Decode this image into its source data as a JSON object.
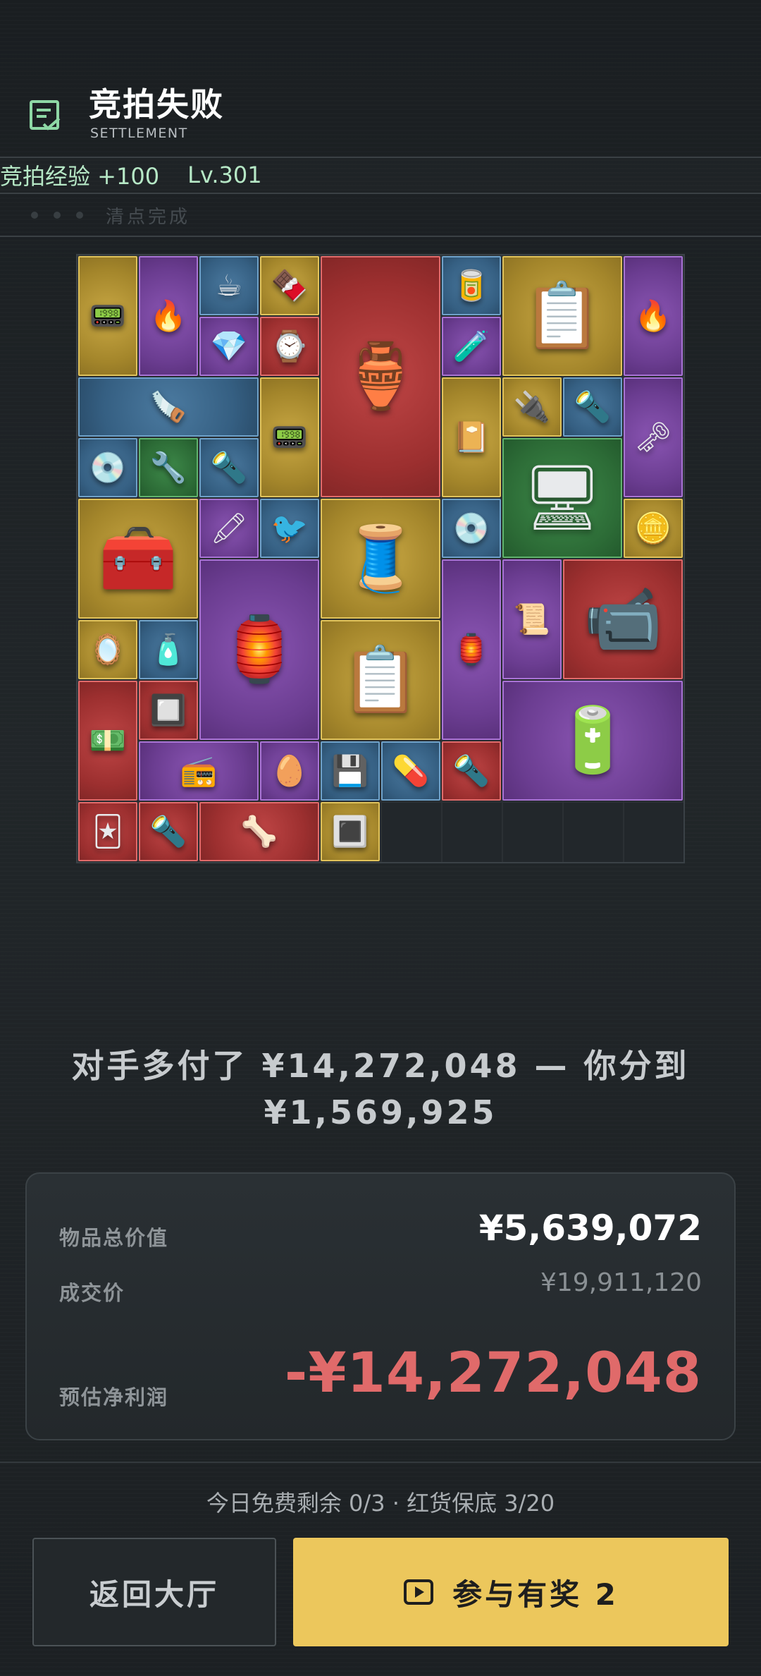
{
  "header": {
    "title": "竞拍失败",
    "subtitle": "SETTLEMENT",
    "exp_label": "竞拍经验 +100",
    "level": "Lv.301",
    "progress_label": "清点完成"
  },
  "items": [
    {
      "name": "handheld-device",
      "rarity": "yellow",
      "icon": "📟"
    },
    {
      "name": "blowtorch",
      "rarity": "purple",
      "icon": "🔥"
    },
    {
      "name": "coffee-bag",
      "rarity": "blue",
      "icon": "☕"
    },
    {
      "name": "chocolate-bar",
      "rarity": "yellow",
      "icon": "🍫"
    },
    {
      "name": "porcelain-ewer",
      "rarity": "red",
      "icon": "🏺"
    },
    {
      "name": "cylinder-container",
      "rarity": "blue",
      "icon": "🥫"
    },
    {
      "name": "clipboard-report",
      "rarity": "yellow",
      "icon": "📋"
    },
    {
      "name": "blowtorch-2",
      "rarity": "purple",
      "icon": "🔥"
    },
    {
      "name": "earrings",
      "rarity": "purple",
      "icon": "💎"
    },
    {
      "name": "watch-reel",
      "rarity": "red",
      "icon": "⌚"
    },
    {
      "name": "glowstick",
      "rarity": "purple",
      "icon": "🧪"
    },
    {
      "name": "hand-saw",
      "rarity": "blue",
      "icon": "🪚"
    },
    {
      "name": "handheld-device-2",
      "rarity": "yellow",
      "icon": "📟"
    },
    {
      "name": "leather-notebook",
      "rarity": "yellow",
      "icon": "📔"
    },
    {
      "name": "usb-key",
      "rarity": "yellow",
      "icon": "🔌"
    },
    {
      "name": "keychain-flashlight",
      "rarity": "blue",
      "icon": "🔦"
    },
    {
      "name": "ornate-key",
      "rarity": "purple",
      "icon": "🗝"
    },
    {
      "name": "cd-disc",
      "rarity": "blue",
      "icon": "💿"
    },
    {
      "name": "pliers",
      "rarity": "green",
      "icon": "🔧"
    },
    {
      "name": "carabiner-light",
      "rarity": "blue",
      "icon": "🔦"
    },
    {
      "name": "power-supply",
      "rarity": "green",
      "icon": "🖥"
    },
    {
      "name": "ammo-crate",
      "rarity": "yellow",
      "icon": "🧰"
    },
    {
      "name": "marker",
      "rarity": "purple",
      "icon": "🖍"
    },
    {
      "name": "bird-figurine",
      "rarity": "blue",
      "icon": "🐦"
    },
    {
      "name": "cable-reel",
      "rarity": "yellow",
      "icon": "🧵"
    },
    {
      "name": "cd-disc-2",
      "rarity": "blue",
      "icon": "💿"
    },
    {
      "name": "emblem-coin",
      "rarity": "yellow",
      "icon": "🪙"
    },
    {
      "name": "moroccan-lamp",
      "rarity": "purple",
      "icon": "🏮"
    },
    {
      "name": "old-lantern",
      "rarity": "purple",
      "icon": "🏮"
    },
    {
      "name": "old-scroll",
      "rarity": "purple",
      "icon": "📜"
    },
    {
      "name": "camcorder",
      "rarity": "red",
      "icon": "📹"
    },
    {
      "name": "compact-mirror",
      "rarity": "yellow",
      "icon": "🪞"
    },
    {
      "name": "spray-bottle",
      "rarity": "blue",
      "icon": "🧴"
    },
    {
      "name": "clipboard-report-2",
      "rarity": "yellow",
      "icon": "📋"
    },
    {
      "name": "car-battery",
      "rarity": "purple",
      "icon": "🔋"
    },
    {
      "name": "banknote",
      "rarity": "red",
      "icon": "💵"
    },
    {
      "name": "circuit-module",
      "rarity": "red",
      "icon": "🔲"
    },
    {
      "name": "boombox",
      "rarity": "purple",
      "icon": "📻"
    },
    {
      "name": "fossil-egg",
      "rarity": "purple",
      "icon": "🥚"
    },
    {
      "name": "usb-drive",
      "rarity": "blue",
      "icon": "💾"
    },
    {
      "name": "pill-bottle",
      "rarity": "blue",
      "icon": "💊"
    },
    {
      "name": "keychain-flashlight-2",
      "rarity": "red",
      "icon": "🔦"
    },
    {
      "name": "ornate-card",
      "rarity": "red",
      "icon": "🃏"
    },
    {
      "name": "keychain-flashlight-3",
      "rarity": "red",
      "icon": "🔦"
    },
    {
      "name": "fossil-claw",
      "rarity": "red",
      "icon": "🦴"
    },
    {
      "name": "cpu-chip",
      "rarity": "yellow",
      "icon": "🔳"
    }
  ],
  "summary": {
    "line1": "对手多付了 ¥14,272,048 — 你分到",
    "line2": "¥1,569,925"
  },
  "card": {
    "total_label": "物品总价值",
    "total_value": "¥5,639,072",
    "price_label": "成交价",
    "price_value": "¥19,911,120",
    "profit_label": "预估净利润",
    "profit_value": "-¥14,272,048",
    "profit_color": "#e06a6a"
  },
  "footer": {
    "free_info": "今日免费剩余 0/3 · 红货保底 3/20",
    "back_label": "返回大厅",
    "join_label": "参与有奖 2"
  },
  "colors": {
    "accent": "#ecc75c",
    "yellow": "#c9a844",
    "purple": "#8a55b3",
    "blue": "#4b7aa0",
    "red": "#c04646",
    "green": "#3e8a4a"
  }
}
